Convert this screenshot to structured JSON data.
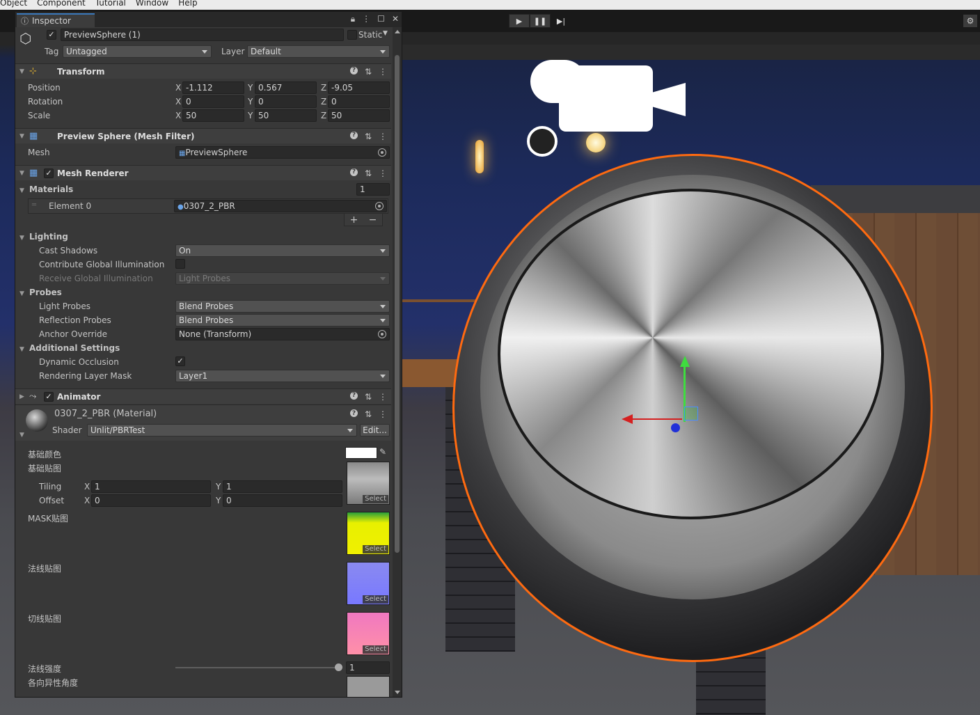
{
  "menu": [
    "Object",
    "Component",
    "Tutorial",
    "Window",
    "Help"
  ],
  "toolbar": {
    "play": "▶",
    "pause": "❚❚",
    "step": "▶|"
  },
  "inspector": {
    "tab_label": "Inspector",
    "object_name": "PreviewSphere (1)",
    "static_label": "Static",
    "tag_label": "Tag",
    "tag_value": "Untagged",
    "layer_label": "Layer",
    "layer_value": "Default",
    "transform": {
      "title": "Transform",
      "position_label": "Position",
      "rotation_label": "Rotation",
      "scale_label": "Scale",
      "position": {
        "x": "-1.112",
        "y": "0.567",
        "z": "-9.05"
      },
      "rotation": {
        "x": "0",
        "y": "0",
        "z": "0"
      },
      "scale": {
        "x": "50",
        "y": "50",
        "z": "50"
      }
    },
    "axes": {
      "x": "X",
      "y": "Y",
      "z": "Z"
    },
    "mesh_filter": {
      "title": "Preview Sphere (Mesh Filter)",
      "mesh_label": "Mesh",
      "mesh_value": "PreviewSphere"
    },
    "mesh_renderer": {
      "title": "Mesh Renderer",
      "materials_label": "Materials",
      "materials_count": "1",
      "element_label": "Element 0",
      "element_value": "0307_2_PBR",
      "add": "+",
      "remove": "−",
      "lighting_label": "Lighting",
      "cast_shadows_label": "Cast Shadows",
      "cast_shadows_value": "On",
      "contribute_gi_label": "Contribute Global Illumination",
      "receive_gi_label": "Receive Global Illumination",
      "receive_gi_value": "Light Probes",
      "probes_label": "Probes",
      "light_probes_label": "Light Probes",
      "light_probes_value": "Blend Probes",
      "reflection_probes_label": "Reflection Probes",
      "reflection_probes_value": "Blend Probes",
      "anchor_override_label": "Anchor Override",
      "anchor_override_value": "None (Transform)",
      "additional_label": "Additional Settings",
      "dynamic_occlusion_label": "Dynamic Occlusion",
      "rendering_layer_label": "Rendering Layer Mask",
      "rendering_layer_value": "Layer1"
    },
    "animator": {
      "title": "Animator"
    },
    "material": {
      "title": "0307_2_PBR (Material)",
      "shader_label": "Shader",
      "shader_value": "Unlit/PBRTest",
      "edit_label": "Edit...",
      "base_color_label": "基础颜色",
      "base_map_label": "基础贴图",
      "tiling_label": "Tiling",
      "offset_label": "Offset",
      "tiling": {
        "x": "1",
        "y": "1"
      },
      "offset": {
        "x": "0",
        "y": "0"
      },
      "mask_label": "MASK贴图",
      "normal_label": "法线贴图",
      "tangent_label": "切线贴图",
      "normal_strength_label": "法线强度",
      "normal_strength_value": "1",
      "aniso_label": "各向异性角度",
      "select_label": "Select"
    }
  },
  "colors": {
    "accent": "#3a79bb",
    "selection_outline": "#ff6a10",
    "base_color": "#ffffff"
  }
}
